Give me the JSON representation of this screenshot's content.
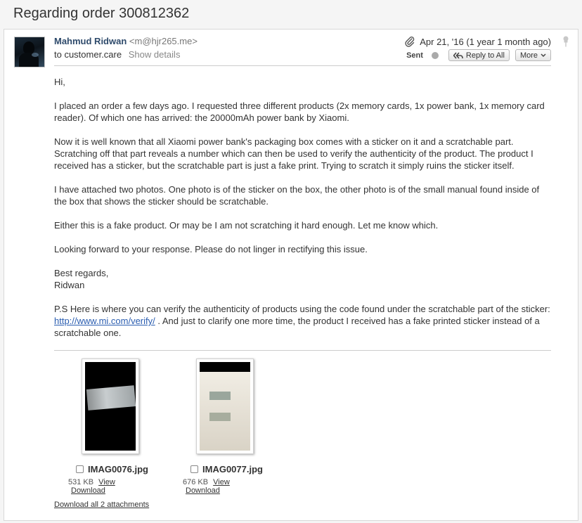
{
  "subject": "Regarding order 300812362",
  "message": {
    "sender_name": "Mahmud Ridwan",
    "sender_email": "<m@hjr265.me>",
    "to_line": "to customer.care",
    "show_details": "Show details",
    "date": "Apr 21, '16 (1 year 1 month ago)",
    "status": "Sent",
    "reply_all": "Reply to All",
    "more": "More"
  },
  "body": {
    "greeting": "Hi,",
    "p1": "I placed an order a few days ago. I requested three different products (2x memory cards, 1x power bank, 1x memory card reader). Of which one has arrived: the 20000mAh power bank by Xiaomi.",
    "p2": "Now it is well known that all Xiaomi power bank's packaging box comes with a sticker on it and a scratchable part. Scratching off that part reveals a number which can then be used to verify the authenticity of the product. The product I received has a sticker, but the scratchable part is just a fake print. Trying to scratch it simply ruins the sticker itself.",
    "p3": "I have attached two photos. One photo is of the sticker on the box, the other photo is of the small manual found inside of the box that shows the sticker should be scratchable.",
    "p4": "Either this is a fake product. Or may be I am not scratching it hard enough. Let me know which.",
    "p5": "Looking forward to your response. Please do not linger in rectifying this issue.",
    "closing": "Best regards,",
    "signature": "Ridwan",
    "ps_before": "P.S Here is where you can verify the authenticity of products using the code found under the scratchable part of the sticker: ",
    "ps_link": "http://www.mi.com/verify/",
    "ps_after": " . And just to clarify one more time, the product I received has a fake printed sticker instead of a scratchable one."
  },
  "attachments": [
    {
      "filename": "IMAG0076.jpg",
      "size": "531 KB",
      "view": "View",
      "download": "Download"
    },
    {
      "filename": "IMAG0077.jpg",
      "size": "676 KB",
      "view": "View",
      "download": "Download"
    }
  ],
  "download_all": "Download all 2 attachments"
}
